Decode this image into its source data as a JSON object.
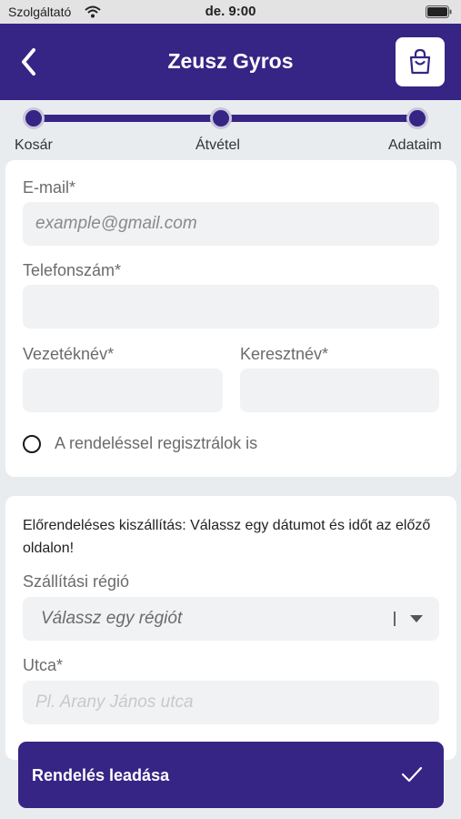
{
  "status_bar": {
    "carrier": "Szolgáltató",
    "time": "de. 9:00"
  },
  "header": {
    "title": "Zeusz Gyros"
  },
  "stepper": {
    "steps": [
      "Kosár",
      "Átvétel",
      "Adataim"
    ]
  },
  "contact_form": {
    "email": {
      "label": "E-mail*",
      "placeholder": "example@gmail.com",
      "value": ""
    },
    "phone": {
      "label": "Telefonszám*",
      "placeholder": "",
      "value": ""
    },
    "last_name": {
      "label": "Vezetéknév*",
      "placeholder": "",
      "value": ""
    },
    "first_name": {
      "label": "Keresztnév*",
      "placeholder": "",
      "value": ""
    },
    "register_option": {
      "label": "A rendeléssel regisztrálok is",
      "checked": false
    }
  },
  "delivery_form": {
    "notice": "Előrendeléses kiszállítás: Válassz egy dátumot és időt az előző oldalon!",
    "region": {
      "label": "Szállítási régió",
      "placeholder": "Válassz egy régiót"
    },
    "street": {
      "label": "Utca*",
      "placeholder": "Pl. Arany János utca",
      "value": ""
    }
  },
  "submit": {
    "label": "Rendelés leadása"
  },
  "colors": {
    "brand": "#362585",
    "field_bg": "#f1f2f4",
    "page_bg": "#e9ecef"
  }
}
